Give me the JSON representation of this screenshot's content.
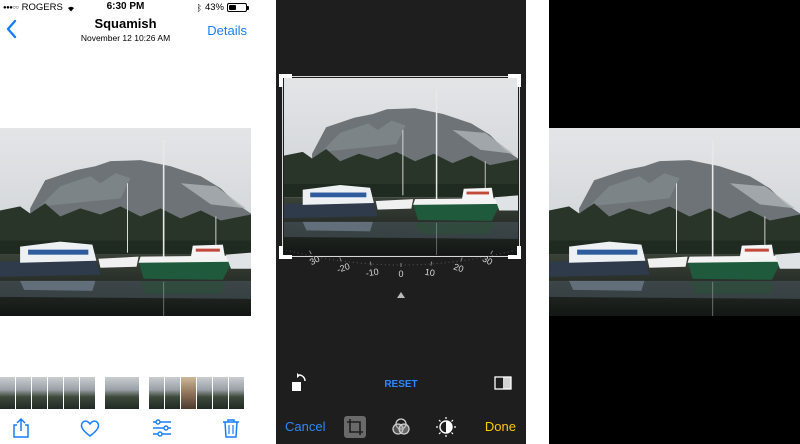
{
  "panel1": {
    "status": {
      "carrier": "ROGERS",
      "time": "6:30 PM",
      "battery": "43%",
      "battery_level": 0.43
    },
    "nav": {
      "title": "Squamish",
      "subtitle": "November 12  10:26 AM",
      "back_icon": "chevron-left-icon",
      "details_label": "Details"
    },
    "toolbar": {
      "icons": [
        "share-icon",
        "heart-icon",
        "adjust-sliders-icon",
        "trash-icon"
      ]
    },
    "accent": "#157efb"
  },
  "panel2": {
    "dial": {
      "ticks": [
        "30",
        "-20",
        "-10",
        "0",
        "10",
        "20",
        "30"
      ]
    },
    "reset_label": "RESET",
    "cancel_label": "Cancel",
    "done_label": "Done",
    "mode_icons": [
      "crop-rotate-icon",
      "filters-icon",
      "light-adjust-icon"
    ],
    "colors": {
      "blue": "#2e87ff",
      "yellow": "#ffcc00"
    }
  },
  "panel3": {
    "background": "#000000"
  }
}
